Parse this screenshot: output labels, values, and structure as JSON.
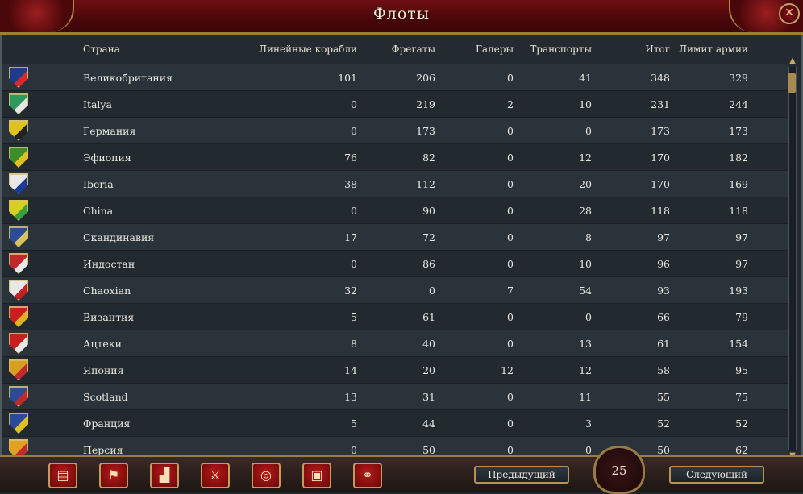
{
  "title": "Флоты",
  "close_icon": "✕",
  "columns": {
    "country": "Страна",
    "ships_of_line": "Линейные корабли",
    "frigates": "Фрегаты",
    "galleys": "Галеры",
    "transports": "Транспорты",
    "total": "Итог",
    "army_limit": "Лимит армии"
  },
  "rows": [
    {
      "name": "Великобритания",
      "lin": "101",
      "fr": "206",
      "gal": "0",
      "tr": "41",
      "tot": "348",
      "lim": "329",
      "flag": "united-kingdom-flag",
      "c1": "#1f3b8c",
      "c2": "#d42a2a"
    },
    {
      "name": "Italya",
      "lin": "0",
      "fr": "219",
      "gal": "2",
      "tr": "10",
      "tot": "231",
      "lim": "244",
      "flag": "italy-flag",
      "c1": "#2a9b5a",
      "c2": "#e6e6e6"
    },
    {
      "name": "Германия",
      "lin": "0",
      "fr": "173",
      "gal": "0",
      "tr": "0",
      "tot": "173",
      "lim": "173",
      "flag": "germany-flag",
      "c1": "#e0c21f",
      "c2": "#222222"
    },
    {
      "name": "Эфиопия",
      "lin": "76",
      "fr": "82",
      "gal": "0",
      "tr": "12",
      "tot": "170",
      "lim": "182",
      "flag": "ethiopia-flag",
      "c1": "#3a8f2a",
      "c2": "#e0c21f"
    },
    {
      "name": "Iberia",
      "lin": "38",
      "fr": "112",
      "gal": "0",
      "tr": "20",
      "tot": "170",
      "lim": "169",
      "flag": "iberia-flag",
      "c1": "#e8e8e8",
      "c2": "#1b3d9a"
    },
    {
      "name": "China",
      "lin": "0",
      "fr": "90",
      "gal": "0",
      "tr": "28",
      "tot": "118",
      "lim": "118",
      "flag": "china-flag",
      "c1": "#d8d020",
      "c2": "#3aa03a"
    },
    {
      "name": "Скандинавия",
      "lin": "17",
      "fr": "72",
      "gal": "0",
      "tr": "8",
      "tot": "97",
      "lim": "97",
      "flag": "scandinavia-flag",
      "c1": "#2b4a9a",
      "c2": "#d8c060"
    },
    {
      "name": "Индостан",
      "lin": "0",
      "fr": "86",
      "gal": "0",
      "tr": "10",
      "tot": "96",
      "lim": "97",
      "flag": "hindustan-flag",
      "c1": "#c02a2a",
      "c2": "#e8e8e8"
    },
    {
      "name": "Chaoxian",
      "lin": "32",
      "fr": "0",
      "gal": "7",
      "tr": "54",
      "tot": "93",
      "lim": "193",
      "flag": "chaoxian-flag",
      "c1": "#e8e8e8",
      "c2": "#c82020"
    },
    {
      "name": "Византия",
      "lin": "5",
      "fr": "61",
      "gal": "0",
      "tr": "0",
      "tot": "66",
      "lim": "79",
      "flag": "byzantium-flag",
      "c1": "#c82020",
      "c2": "#e0b020"
    },
    {
      "name": "Ацтеки",
      "lin": "8",
      "fr": "40",
      "gal": "0",
      "tr": "13",
      "tot": "61",
      "lim": "154",
      "flag": "aztec-flag",
      "c1": "#c82020",
      "c2": "#e8e8e8"
    },
    {
      "name": "Япония",
      "lin": "14",
      "fr": "20",
      "gal": "12",
      "tr": "12",
      "tot": "58",
      "lim": "95",
      "flag": "japan-flag",
      "c1": "#d8a020",
      "c2": "#c02a2a"
    },
    {
      "name": "Scotland",
      "lin": "13",
      "fr": "31",
      "gal": "0",
      "tr": "11",
      "tot": "55",
      "lim": "75",
      "flag": "scotland-flag",
      "c1": "#2b4a9a",
      "c2": "#c02a2a"
    },
    {
      "name": "Франция",
      "lin": "5",
      "fr": "44",
      "gal": "0",
      "tr": "3",
      "tot": "52",
      "lim": "52",
      "flag": "france-flag",
      "c1": "#2b4a9a",
      "c2": "#e0c21f"
    },
    {
      "name": "Персия",
      "lin": "0",
      "fr": "50",
      "gal": "0",
      "tr": "0",
      "tot": "50",
      "lim": "62",
      "flag": "persia-flag",
      "c1": "#e0a020",
      "c2": "#c02a2a"
    }
  ],
  "toolbar": [
    {
      "icon": "ledger-icon",
      "glyph": "▤"
    },
    {
      "icon": "flag-icon",
      "glyph": "⚑"
    },
    {
      "icon": "buildings-icon",
      "glyph": "▟"
    },
    {
      "icon": "crossed-swords-icon",
      "glyph": "⚔"
    },
    {
      "icon": "coins-icon",
      "glyph": "◎"
    },
    {
      "icon": "crate-icon",
      "glyph": "▣"
    },
    {
      "icon": "handshake-icon",
      "glyph": "⚭"
    }
  ],
  "nav": {
    "prev": "Предыдущий",
    "next": "Следующий",
    "page": "25"
  }
}
